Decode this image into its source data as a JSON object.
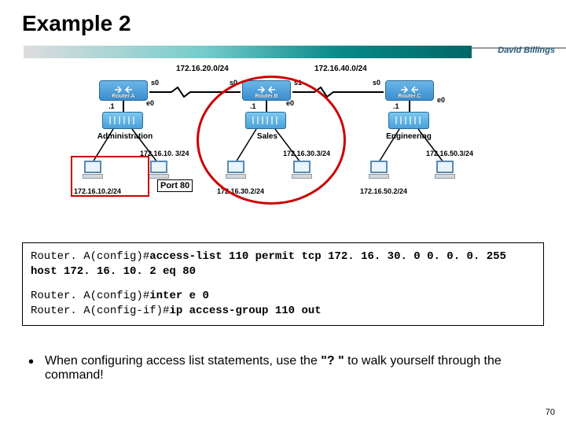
{
  "title": "Example 2",
  "author": "David Billings",
  "topology": {
    "nets": {
      "ab": "172.16.20.0/24",
      "bc": "172.16.40.0/24"
    },
    "routers": {
      "a": {
        "name": "Router.A",
        "s0": "s0",
        "e0": "e0",
        "e0_ip": ".1"
      },
      "b": {
        "name": "Router.B",
        "s0": "s0",
        "s1": "s1",
        "e0": "e0",
        "e0_ip": ".1"
      },
      "c": {
        "name": "Router.C",
        "s0": "s0",
        "e0": "e0",
        "e0_ip": ".1"
      }
    },
    "segments": {
      "admin": {
        "label": "Administration",
        "net": "172.16.10. 3/24",
        "pc_ip": "172.16.10.2/24"
      },
      "sales": {
        "label": "Sales",
        "net": "172.16.30.3/24",
        "pc_ip": "172.16.30.2/24"
      },
      "eng": {
        "label": "Engineering",
        "net": "172.16.50.3/24",
        "pc_ip": "172.16.50.2/24"
      }
    },
    "annotation": {
      "port": "Port 80"
    }
  },
  "config": {
    "prompt1": "Router. A(config)#",
    "cmd1": "access-list 110 permit tcp 172. 16. 30. 0 0. 0. 0. 255 host 172. 16. 10. 2 eq 80",
    "prompt2": "Router. A(config)#",
    "cmd2": "inter e 0",
    "prompt3": "Router. A(config-if)#",
    "cmd3": "ip access-group 110 out"
  },
  "bullet": {
    "text_a": "When configuring access list statements, use the ",
    "quote": "\"? \"",
    "text_b": " to walk yourself through the command!"
  },
  "page": "70"
}
